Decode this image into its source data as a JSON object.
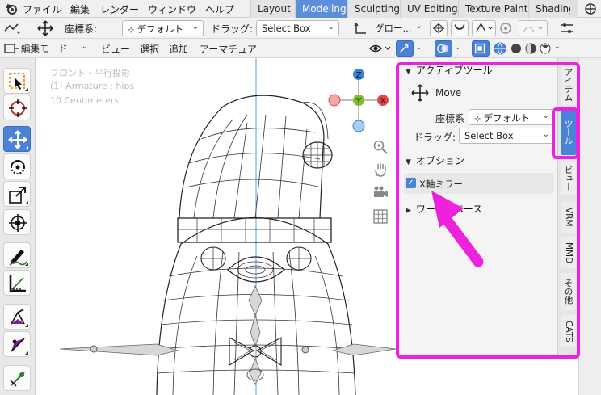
{
  "menubar": {
    "items": [
      "ファイル",
      "編集",
      "レンダー",
      "ウィンドウ",
      "ヘルプ"
    ],
    "workspace_tabs": [
      "Layout",
      "Modeling",
      "Sculpting",
      "UV Editing",
      "Texture Paint",
      "Shading"
    ],
    "active_tab": "Modeling"
  },
  "header1": {
    "orientation_label": "座標系:",
    "orientation_value": "デフォルト",
    "drag_label": "ドラッグ:",
    "drag_value": "Select Box",
    "transform_pivot_value": "グロー..."
  },
  "header2": {
    "mode_value": "編集モード",
    "menus": [
      "ビュー",
      "選択",
      "追加",
      "アーマチュア"
    ]
  },
  "viewport": {
    "overlay_lines": [
      "フロント・平行投影",
      "(1) Armature : hips",
      "10 Centimeters"
    ],
    "gizmo": {
      "z": "Z",
      "y": "Y",
      "x": "X"
    }
  },
  "sidebar": {
    "active_tool_title": "アクティブツール",
    "tool_name": "Move",
    "orientation_label": "座標系",
    "orientation_value": "デフォルト",
    "drag_label": "ドラッグ:",
    "drag_value": "Select Box",
    "options_title": "オプション",
    "x_mirror_label": "X軸ミラー",
    "x_mirror_checked": true,
    "workspace_title": "ワークスペース"
  },
  "sidebar_tabs": [
    "アイテム",
    "ツール",
    "ビュー",
    "VRM",
    "MMD",
    "その他",
    "CATS"
  ],
  "active_sidebar_tab": "ツール",
  "colors": {
    "accent": "#4a82d8",
    "highlight": "#ee22dd",
    "gizmo_x": "#e04848",
    "gizmo_y": "#7bbf2a",
    "gizmo_z": "#3b82d9"
  }
}
